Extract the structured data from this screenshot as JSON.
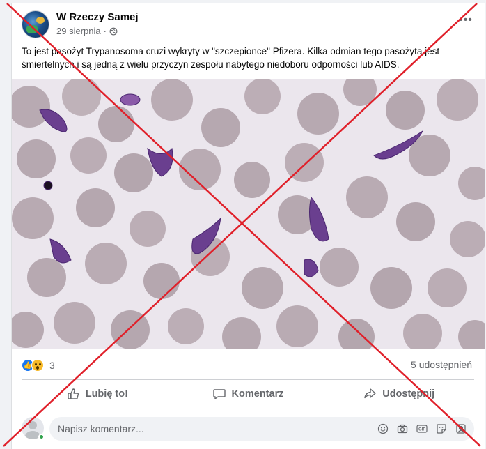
{
  "post": {
    "page_name": "W Rzeczy Samej",
    "date": "29 sierpnia",
    "separator": "·",
    "text": "To jest pasożyt Trypanosoma cruzi wykryty w \"szczepionce\" Pfizera. Kilka odmian tego pasożyta jest śmiertelnych i są jedną z wielu przyczyn zespołu nabytego niedoboru odporności lub AIDS.",
    "more_icon": "more-options-icon",
    "visibility_icon": "globe-icon",
    "image_description_icon": "microscope-image"
  },
  "footer": {
    "reaction_count": "3",
    "reactions": [
      "like",
      "wow"
    ],
    "shares": "5 udostępnień"
  },
  "actions": {
    "like": "Lubię to!",
    "comment": "Komentarz",
    "share": "Udostępnij"
  },
  "comment_box": {
    "placeholder": "Napisz komentarz...",
    "tools": [
      "emoji-icon",
      "camera-icon",
      "gif-icon",
      "sticker-icon",
      "avatar-sticker-icon"
    ]
  },
  "colors": {
    "cross": "#e0202a",
    "brand": "#1877f2",
    "secondary_text": "#65676b"
  }
}
